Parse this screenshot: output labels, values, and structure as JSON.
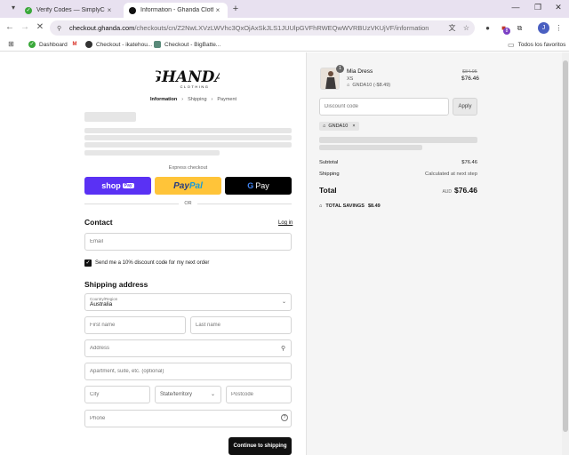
{
  "browser": {
    "tabs": [
      {
        "title": "Verify Codes — SimplyCodes",
        "active": false
      },
      {
        "title": "Information - Ghanda Clothing",
        "active": true
      }
    ],
    "address": {
      "host": "checkout.ghanda.com",
      "path": "/checkouts/cn/Z2NwLXVzLWVhc3QxOjAxSkJLS1JUUlpGVFhRWEQwWVRBUzVKUjVF/information"
    },
    "bookmarks": [
      "Dashboard",
      "",
      "Checkout - ikatehou...",
      "Checkout - BigBatte..."
    ],
    "all_bookmarks": "Todos los favoritos",
    "profile_initial": "J",
    "ext_badge": "8"
  },
  "checkout": {
    "logo_text": "GHANDA",
    "logo_sub": "CLOTHING",
    "breadcrumbs": [
      "Information",
      "Shipping",
      "Payment"
    ],
    "express_label": "Express checkout",
    "shop_pay": {
      "shop": "shop",
      "pay": "Pay"
    },
    "paypal": {
      "pay": "Pay",
      "pal": "Pal"
    },
    "gpay": {
      "g": "G",
      "pay": "Pay"
    },
    "or_label": "OR",
    "contact": {
      "heading": "Contact",
      "login_link": "Log in",
      "email_placeholder": "Email",
      "newsletter_label": "Send me a 10% discount code for my next order"
    },
    "shipping": {
      "heading": "Shipping address",
      "country_label": "Country/Region",
      "country_value": "Australia",
      "first_name": "First name",
      "last_name": "Last name",
      "address": "Address",
      "apartment": "Apartment, suite, etc. (optional)",
      "city": "City",
      "state": "State/territory",
      "postcode": "Postcode",
      "phone": "Phone"
    },
    "continue_label": "Continue to shipping"
  },
  "summary": {
    "item": {
      "name": "Mia Dress",
      "variant": "XS",
      "discount": "GNDA10 (-$8.49)",
      "original_price": "$84.95",
      "price": "$76.46",
      "quantity": "1"
    },
    "discount_placeholder": "Discount code",
    "apply_label": "Apply",
    "applied_code": "GNDA10",
    "subtotal_label": "Subtotal",
    "subtotal_value": "$76.46",
    "shipping_label": "Shipping",
    "shipping_value": "Calculated at next step",
    "total_label": "Total",
    "currency": "AUD",
    "total_value": "$76.46",
    "savings_label": "TOTAL SAVINGS",
    "savings_value": "$8.49"
  }
}
